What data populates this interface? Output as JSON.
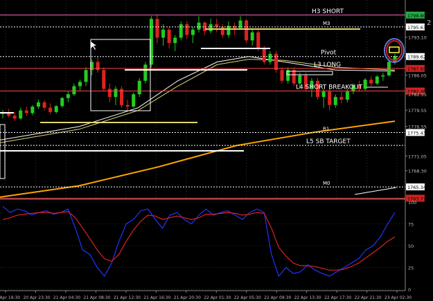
{
  "chart_data": [
    {
      "type": "candlestick",
      "price_axis": {
        "ylim": [
          1763.0,
          1800.0
        ],
        "tick_labels": [
          "1793.10",
          "1786.05",
          "1782.55",
          "1779.55",
          "1776.55",
          "1771.05",
          "1768.30"
        ]
      },
      "time_axis": {
        "labels": [
          "20 Apr 19:30",
          "20 Apr 23:30",
          "21 Apr 04:30",
          "21 Apr 08:30",
          "21 Apr 12:30",
          "21 Apr 16:30",
          "21 Apr 20:30",
          "22 Apr 01:30",
          "22 Apr 05:30",
          "22 Apr 09:30",
          "22 Apr 13:30",
          "22 Apr 17:30",
          "22 Apr 21:30",
          "23 Apr 02:30"
        ]
      },
      "right_edge_note": "2",
      "levels": [
        {
          "label": "H3 SHORT",
          "price": 1797.2,
          "tag": "1798.80",
          "color": "#ff66cc"
        },
        {
          "label": "M3",
          "price": 1795.0,
          "tag": "1795.63",
          "color": "#ffffff"
        },
        {
          "label": "Pivot",
          "price": 1789.5,
          "tag": "1789.62",
          "color": "#ffffff"
        },
        {
          "label": "L3 LONG",
          "price": 1787.3,
          "tag": "1787.65",
          "color": "#ff4444"
        },
        {
          "label": "L4 SHORT BREAKOUT",
          "price": 1783.1,
          "tag": "1782.40",
          "color": "#ff4444"
        },
        {
          "label": "R1",
          "price": 1775.4,
          "tag": "1775.43",
          "color": "#ffffff"
        },
        {
          "label": "L5 SB TARGET",
          "price": 1773.0,
          "tag": "",
          "color": "#ffffff"
        },
        {
          "label": "M0",
          "price": 1765.3,
          "tag": "1765.34",
          "color": "#ffffff"
        },
        {
          "label": "",
          "price": 1763.2,
          "tag": "1763.77",
          "color": "#ff4444"
        }
      ],
      "candles": [
        [
          1778.9,
          1779.6,
          1778.0,
          1779.0
        ],
        [
          1779.0,
          1779.8,
          1778.2,
          1778.5
        ],
        [
          1778.5,
          1779.2,
          1777.5,
          1778.0
        ],
        [
          1778.0,
          1780.0,
          1777.8,
          1779.5
        ],
        [
          1779.5,
          1780.2,
          1778.5,
          1779.0
        ],
        [
          1779.0,
          1780.5,
          1778.6,
          1780.2
        ],
        [
          1780.2,
          1781.5,
          1779.8,
          1781.0
        ],
        [
          1781.0,
          1781.4,
          1779.5,
          1780.0
        ],
        [
          1780.0,
          1780.8,
          1778.8,
          1779.2
        ],
        [
          1779.2,
          1780.5,
          1778.9,
          1780.3
        ],
        [
          1780.3,
          1782.0,
          1780.0,
          1781.8
        ],
        [
          1781.8,
          1783.0,
          1781.0,
          1782.5
        ],
        [
          1782.5,
          1784.5,
          1782.2,
          1784.0
        ],
        [
          1784.0,
          1785.2,
          1783.2,
          1784.8
        ],
        [
          1784.8,
          1787.5,
          1784.0,
          1787.0
        ],
        [
          1787.0,
          1789.0,
          1786.0,
          1788.5
        ],
        [
          1788.5,
          1789.5,
          1786.5,
          1787.0
        ],
        [
          1787.0,
          1787.5,
          1783.0,
          1783.5
        ],
        [
          1783.5,
          1784.5,
          1781.0,
          1782.0
        ],
        [
          1782.0,
          1784.0,
          1780.5,
          1783.5
        ],
        [
          1783.5,
          1784.0,
          1780.0,
          1780.5
        ],
        [
          1780.5,
          1781.5,
          1779.5,
          1780.2
        ],
        [
          1780.2,
          1782.8,
          1780.0,
          1782.5
        ],
        [
          1782.5,
          1785.5,
          1782.0,
          1785.0
        ],
        [
          1785.0,
          1788.5,
          1784.5,
          1788.0
        ],
        [
          1788.0,
          1797.0,
          1787.5,
          1796.5
        ],
        [
          1796.5,
          1797.2,
          1792.0,
          1793.0
        ],
        [
          1793.0,
          1795.5,
          1791.5,
          1794.5
        ],
        [
          1794.5,
          1795.0,
          1791.0,
          1792.0
        ],
        [
          1792.0,
          1793.5,
          1790.5,
          1793.0
        ],
        [
          1793.0,
          1796.0,
          1792.5,
          1795.5
        ],
        [
          1795.5,
          1796.0,
          1792.8,
          1793.5
        ],
        [
          1793.5,
          1795.0,
          1792.0,
          1794.5
        ],
        [
          1794.5,
          1797.0,
          1794.0,
          1795.8
        ],
        [
          1795.8,
          1796.0,
          1793.5,
          1794.2
        ],
        [
          1794.2,
          1796.5,
          1793.8,
          1795.5
        ],
        [
          1795.5,
          1796.5,
          1794.0,
          1795.0
        ],
        [
          1795.0,
          1795.5,
          1793.0,
          1793.5
        ],
        [
          1793.5,
          1796.0,
          1793.0,
          1795.2
        ],
        [
          1795.2,
          1795.8,
          1793.5,
          1794.8
        ],
        [
          1794.8,
          1797.0,
          1794.5,
          1796.2
        ],
        [
          1796.2,
          1796.5,
          1792.0,
          1792.5
        ],
        [
          1792.5,
          1794.5,
          1791.5,
          1794.0
        ],
        [
          1794.0,
          1794.5,
          1790.5,
          1791.0
        ],
        [
          1791.0,
          1791.5,
          1788.0,
          1788.5
        ],
        [
          1788.5,
          1790.5,
          1788.0,
          1790.0
        ],
        [
          1790.0,
          1790.5,
          1786.5,
          1787.0
        ],
        [
          1787.0,
          1787.5,
          1784.5,
          1785.0
        ],
        [
          1785.0,
          1787.5,
          1784.5,
          1787.0
        ],
        [
          1787.0,
          1787.5,
          1784.0,
          1784.5
        ],
        [
          1784.5,
          1786.5,
          1783.5,
          1786.0
        ],
        [
          1786.0,
          1786.5,
          1783.0,
          1783.5
        ],
        [
          1783.5,
          1785.5,
          1782.0,
          1785.0
        ],
        [
          1785.0,
          1785.5,
          1781.5,
          1782.0
        ],
        [
          1782.0,
          1783.5,
          1780.0,
          1783.0
        ],
        [
          1783.0,
          1783.5,
          1779.5,
          1780.5
        ],
        [
          1780.5,
          1782.5,
          1780.0,
          1782.0
        ],
        [
          1782.0,
          1783.0,
          1780.8,
          1781.5
        ],
        [
          1781.5,
          1783.5,
          1781.0,
          1783.0
        ],
        [
          1783.0,
          1784.5,
          1782.5,
          1784.2
        ],
        [
          1784.2,
          1785.0,
          1783.0,
          1783.5
        ],
        [
          1783.5,
          1785.5,
          1783.2,
          1785.2
        ],
        [
          1785.2,
          1785.8,
          1784.0,
          1784.5
        ],
        [
          1784.5,
          1786.0,
          1784.2,
          1785.8
        ],
        [
          1785.8,
          1786.5,
          1785.0,
          1786.0
        ],
        [
          1786.0,
          1789.0,
          1785.8,
          1788.5
        ],
        [
          1788.5,
          1790.0,
          1788.0,
          1789.6
        ]
      ],
      "moving_averages": [
        {
          "color": "#ffffff",
          "points": [
            [
              0,
              1774.0
            ],
            [
              0.2,
              1776.5
            ],
            [
              0.35,
              1780.0
            ],
            [
              0.45,
              1785.0
            ],
            [
              0.55,
              1788.5
            ],
            [
              0.63,
              1789.5
            ],
            [
              0.72,
              1788.5
            ],
            [
              0.85,
              1787.0
            ],
            [
              1,
              1786.8
            ]
          ]
        },
        {
          "color": "#e0d870",
          "points": [
            [
              0,
              1773.5
            ],
            [
              0.2,
              1776.0
            ],
            [
              0.35,
              1779.5
            ],
            [
              0.45,
              1784.0
            ],
            [
              0.55,
              1788.0
            ],
            [
              0.63,
              1789.0
            ],
            [
              0.72,
              1788.8
            ],
            [
              0.85,
              1787.5
            ],
            [
              1,
              1787.0
            ]
          ]
        },
        {
          "color": "#ffa500",
          "points": [
            [
              0,
              1763.4
            ],
            [
              0.2,
              1765.5
            ],
            [
              0.4,
              1769.0
            ],
            [
              0.6,
              1773.0
            ],
            [
              0.8,
              1775.5
            ],
            [
              1,
              1777.5
            ]
          ]
        }
      ],
      "oscillator": {
        "ylim": [
          0,
          100
        ],
        "tick_labels": [
          "100",
          "75",
          "50",
          "25",
          "0"
        ],
        "series": [
          {
            "color": "#2233ff",
            "values": [
              95,
              88,
              92,
              90,
              85,
              88,
              90,
              86,
              88,
              92,
              70,
              45,
              40,
              25,
              15,
              30,
              55,
              75,
              80,
              90,
              92,
              80,
              70,
              85,
              88,
              80,
              75,
              85,
              92,
              85,
              88,
              90,
              85,
              80,
              88,
              92,
              88,
              40,
              15,
              25,
              18,
              20,
              28,
              22,
              18,
              15,
              20,
              25,
              30,
              35,
              45,
              50,
              60,
              75,
              88
            ]
          },
          {
            "color": "#dd2222",
            "values": [
              80,
              82,
              85,
              86,
              87,
              88,
              88,
              87,
              88,
              89,
              82,
              70,
              58,
              45,
              35,
              32,
              40,
              55,
              68,
              78,
              85,
              84,
              80,
              82,
              84,
              82,
              80,
              82,
              86,
              86,
              87,
              88,
              87,
              85,
              86,
              88,
              87,
              70,
              48,
              38,
              30,
              27,
              27,
              26,
              24,
              22,
              22,
              23,
              26,
              30,
              36,
              42,
              48,
              55,
              60
            ]
          }
        ]
      }
    }
  ]
}
